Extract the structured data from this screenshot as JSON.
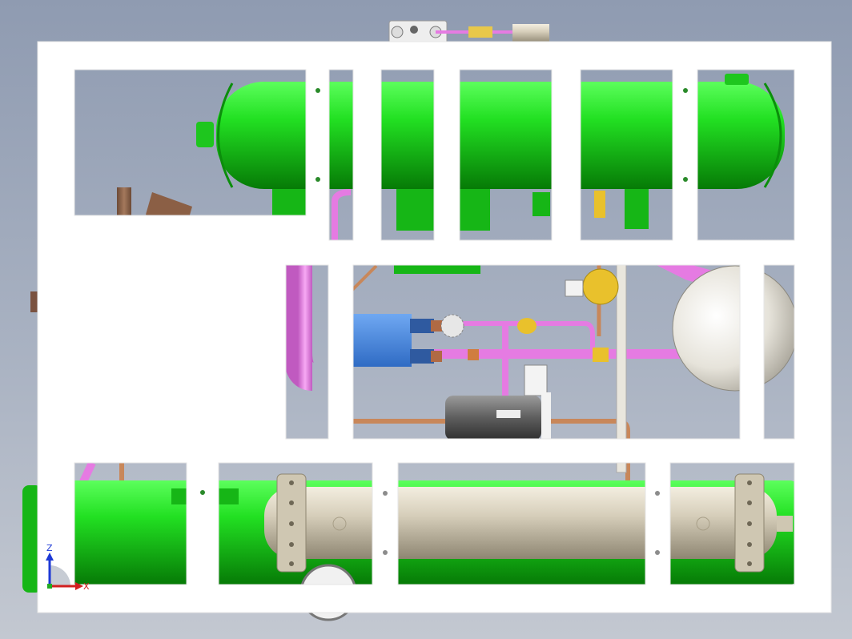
{
  "viewport": {
    "background_top": "#8f9bb1",
    "background_bottom": "#c3c8d1",
    "model": {
      "frame_color": "#ffffff",
      "receiver_color": "#1fdc1f",
      "heat_exchanger_color": "#d9d2c0",
      "refrigerant_pipe_color": "#e57be2",
      "copper_pipe_color": "#c8875a",
      "valve_color": "#e9c12c",
      "motor_color": "#4a8ee0"
    }
  },
  "triad": {
    "z_label": "Z",
    "x_label": "X",
    "z_color": "#1d39d6",
    "x_color": "#d21f1f"
  }
}
